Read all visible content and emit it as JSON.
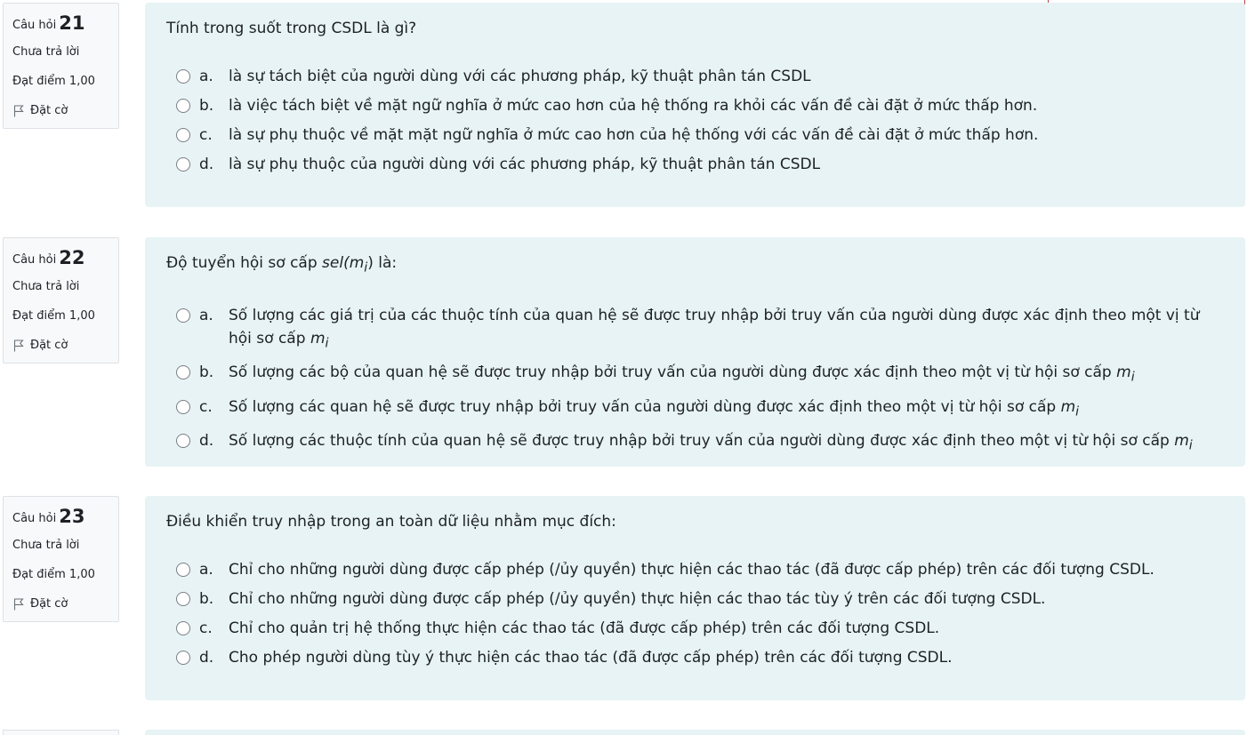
{
  "questions": [
    {
      "label": "Câu hỏi",
      "number": "21",
      "status": "Chưa trả lời",
      "points": "Đạt điểm 1,00",
      "flag_label": "Đặt cờ",
      "text": "Tính trong suốt trong CSDL là gì?",
      "answers": [
        {
          "letter": "a.",
          "text": "là sự tách biệt của người dùng với các phương pháp, kỹ thuật phân tán CSDL"
        },
        {
          "letter": "b.",
          "text": "là việc tách biệt về mặt ngữ nghĩa ở mức cao hơn của hệ thống ra khỏi các vấn đề cài đặt ở mức thấp hơn."
        },
        {
          "letter": "c.",
          "text": "là sự phụ thuộc về mặt mặt ngữ nghĩa ở mức cao hơn của hệ thống với các vấn đề cài đặt ở mức thấp hơn."
        },
        {
          "letter": "d.",
          "text": "là sự phụ thuộc của người dùng với các phương pháp, kỹ thuật phân tán CSDL"
        }
      ]
    },
    {
      "label": "Câu hỏi",
      "number": "22",
      "status": "Chưa trả lời",
      "points": "Đạt điểm 1,00",
      "flag_label": "Đặt cờ",
      "text_prefix": "Độ tuyển hội sơ cấp ",
      "text_math": "sel(m",
      "text_sub": "i",
      "text_close": ")",
      "text_suffix": " là:",
      "answers": [
        {
          "letter": "a.",
          "text": "Số lượng các giá trị của các thuộc tính của quan hệ sẽ được truy nhập bởi truy vấn của người dùng được xác định theo một vị từ hội sơ cấp ",
          "math": "m",
          "sub": "i"
        },
        {
          "letter": "b.",
          "text": "Số lượng các bộ của quan hệ sẽ được truy nhập bởi truy vấn của người dùng được xác định theo một vị từ hội sơ cấp ",
          "math": "m",
          "sub": "i"
        },
        {
          "letter": "c.",
          "text": "Số lượng các quan hệ sẽ được truy nhập bởi truy vấn của người dùng được xác định theo một vị từ hội sơ cấp ",
          "math": "m",
          "sub": "i"
        },
        {
          "letter": "d.",
          "text": "Số lượng các thuộc tính của quan hệ sẽ được truy nhập bởi truy vấn của người dùng được xác định theo một vị từ hội sơ cấp ",
          "math": "m",
          "sub": "i"
        }
      ]
    },
    {
      "label": "Câu hỏi",
      "number": "23",
      "status": "Chưa trả lời",
      "points": "Đạt điểm 1,00",
      "flag_label": "Đặt cờ",
      "text": "Điều khiển truy nhập trong an toàn dữ liệu nhằm mục đích:",
      "answers": [
        {
          "letter": "a.",
          "text": "Chỉ cho những người dùng được cấp phép (/ủy quyền) thực hiện các thao tác (đã được cấp phép) trên các đối tượng CSDL."
        },
        {
          "letter": "b.",
          "text": "Chỉ cho những người dùng được cấp phép (/ủy quyền) thực hiện các thao tác tùy ý trên các đối tượng CSDL."
        },
        {
          "letter": "c.",
          "text": "Chỉ cho quản trị hệ thống thực hiện các thao tác (đã được cấp phép) trên các đối tượng CSDL."
        },
        {
          "letter": "d.",
          "text": "Cho phép người dùng tùy ý thực hiện các thao tác (đã được cấp phép) trên các đối tượng CSDL."
        }
      ]
    }
  ],
  "icons": {
    "flag": "flag-icon",
    "radio": "radio-button"
  },
  "colors": {
    "content_bg": "#e7f3f5",
    "info_bg": "#f8f9fa",
    "border": "#dee2e6"
  }
}
